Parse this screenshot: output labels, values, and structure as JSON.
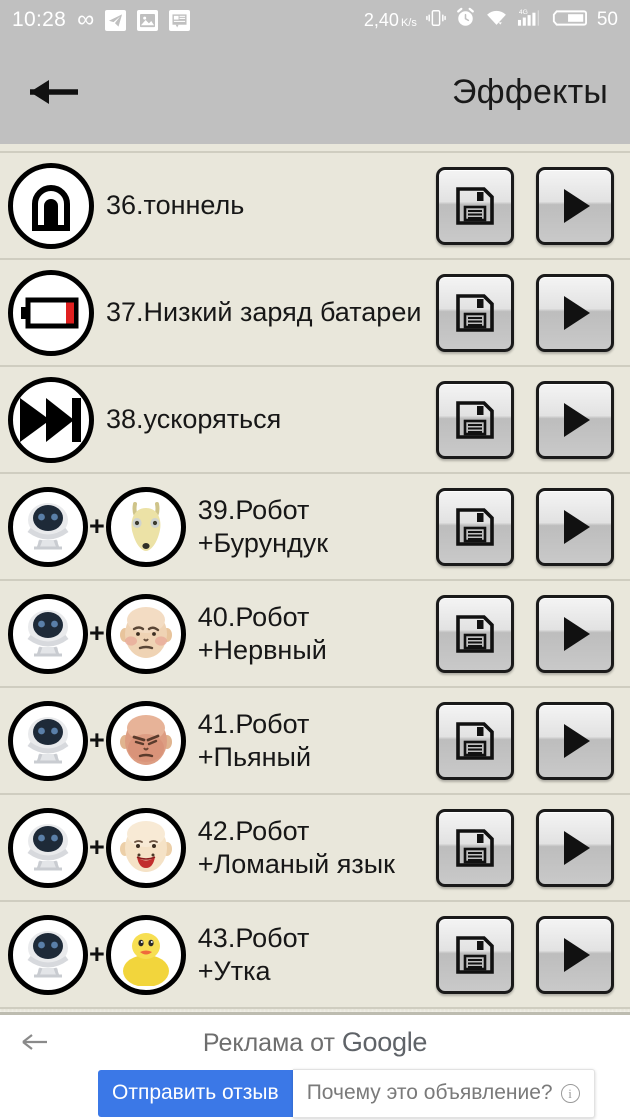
{
  "statusbar": {
    "clock": "10:28",
    "infinity_icon": "infinity-icon",
    "telegram_icon": "telegram-icon",
    "gallery_icon": "gallery-icon",
    "news_icon": "news-icon",
    "data_speed": "2,40",
    "data_speed_unit": "K/s",
    "vibrate_icon": "vibrate-icon",
    "alarm_icon": "alarm-icon",
    "wifi_icon": "wifi-icon",
    "signal_icon": "signal-4g-icon",
    "signal_label": "4G",
    "battery_icon": "battery-icon",
    "battery_level": "50"
  },
  "appbar": {
    "back_icon": "back-arrow-icon",
    "title": "Эффекты"
  },
  "list": {
    "rows": [
      {
        "id": "partial",
        "label": "",
        "type": "partial"
      },
      {
        "id": "36",
        "label": "36.тоннель",
        "icon": "tunnel-icon",
        "type": "single"
      },
      {
        "id": "37",
        "label": "37.Низкий заряд батареи",
        "icon": "low-battery-icon",
        "type": "single"
      },
      {
        "id": "38",
        "label": "38.ускоряться",
        "icon": "fast-forward-icon",
        "type": "single"
      },
      {
        "id": "39",
        "label": "39.Робот\n+Бурундук",
        "icon": "robot-icon",
        "icon2": "chipmunk-icon",
        "type": "combo"
      },
      {
        "id": "40",
        "label": "40.Робот\n+Нервный",
        "icon": "robot-icon",
        "icon2": "nervous-face-icon",
        "type": "combo"
      },
      {
        "id": "41",
        "label": "41.Робот\n+Пьяный",
        "icon": "robot-icon",
        "icon2": "drunk-face-icon",
        "type": "combo"
      },
      {
        "id": "42",
        "label": "42.Робот\n+Ломаный язык",
        "icon": "robot-icon",
        "icon2": "tongue-face-icon",
        "type": "combo"
      },
      {
        "id": "43",
        "label": "43.Робот\n+Утка",
        "icon": "robot-icon",
        "icon2": "duck-icon",
        "type": "combo"
      }
    ],
    "plus_symbol": "+",
    "save_button_icon": "floppy-save-icon",
    "play_button_icon": "play-icon"
  },
  "ad": {
    "back_icon": "ad-back-arrow-icon",
    "title_prefix": "Реклама от ",
    "brand": "Google",
    "feedback_label": "Отправить отзыв",
    "why_label": "Почему это объявление?",
    "info_icon": "info-icon"
  },
  "colors": {
    "statusbar_bg": "#c0c0c0",
    "appbar_bg": "#c0c0c0",
    "list_bg": "#e9e7db",
    "divider": "#cfcdc0",
    "accent_blue": "#3b78e7",
    "battery_red": "#e02020",
    "duck_yellow": "#f2d53c"
  }
}
